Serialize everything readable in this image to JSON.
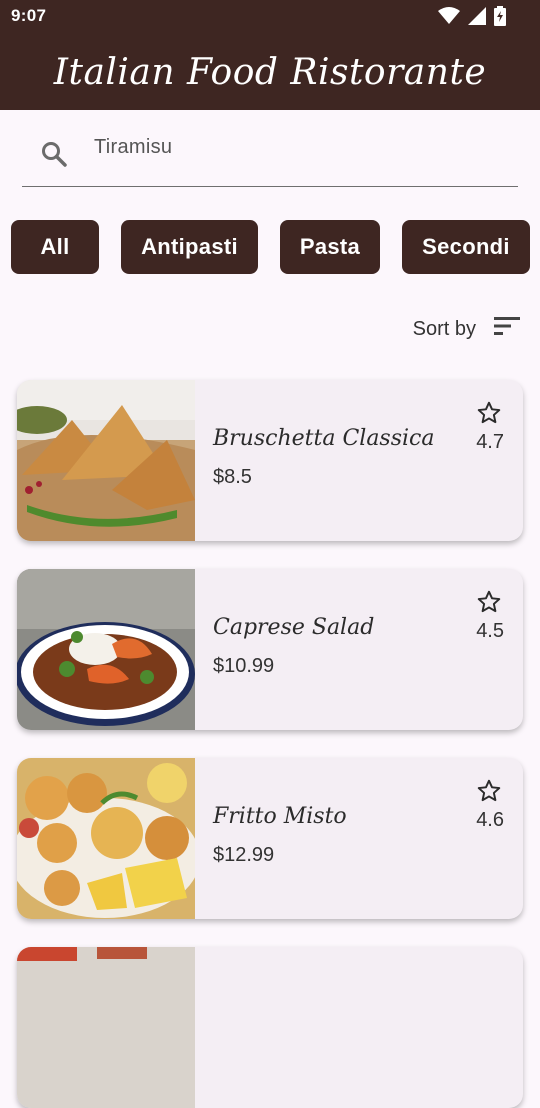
{
  "status_bar": {
    "time": "9:07",
    "icons": [
      "wifi-icon",
      "signal-icon",
      "battery-icon"
    ]
  },
  "app_bar": {
    "title": "Italian Food Ristorante"
  },
  "search": {
    "value": "Tiramisu",
    "icon": "search-icon"
  },
  "categories": [
    {
      "label": "All"
    },
    {
      "label": "Antipasti"
    },
    {
      "label": "Pasta"
    },
    {
      "label": "Secondi"
    }
  ],
  "sort": {
    "label": "Sort by",
    "icon": "sort-icon"
  },
  "menu_items": [
    {
      "name": "Bruschetta Classica",
      "price": "$8.5",
      "rating": "4.7",
      "image": "samosa-photo"
    },
    {
      "name": "Caprese Salad",
      "price": "$10.99",
      "rating": "4.5",
      "image": "shrimp-bowl-photo"
    },
    {
      "name": "Fritto Misto",
      "price": "$12.99",
      "rating": "4.6",
      "image": "fried-seafood-photo"
    },
    {
      "name": "",
      "price": "",
      "rating": "",
      "image": "partial-photo"
    }
  ],
  "colors": {
    "primary": "#3E2622",
    "background": "#FCF7FC",
    "card": "#F4EEF4"
  }
}
